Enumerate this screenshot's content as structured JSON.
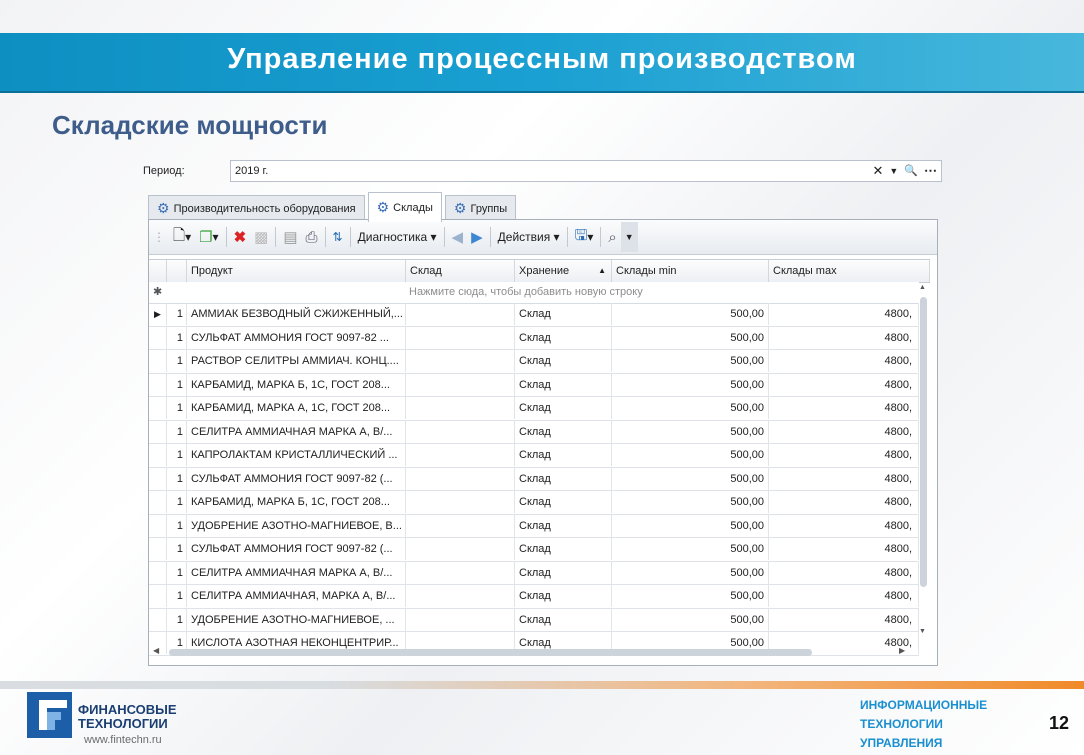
{
  "slide": {
    "title": "Управление процессным производством",
    "subtitle": "Складские мощности",
    "page_number": "12"
  },
  "period": {
    "label": "Период:",
    "value": "2019 г."
  },
  "tabs": [
    {
      "label": "Производительность оборудования",
      "active": false
    },
    {
      "label": "Склады",
      "active": true
    },
    {
      "label": "Группы",
      "active": false
    }
  ],
  "toolbar": {
    "diagnostics_label": "Диагностика",
    "actions_label": "Действия"
  },
  "grid": {
    "columns": [
      "Продукт",
      "Склад",
      "Хранение",
      "Склады min",
      "Склады max"
    ],
    "new_row_hint": "Нажмите сюда, чтобы добавить новую строку",
    "rows": [
      {
        "num": "1",
        "product": "АММИАК БЕЗВОДНЫЙ СЖИЖЕННЫЙ,...",
        "sklad": "",
        "storage": "Склад",
        "min": "500,00",
        "max": "4800,"
      },
      {
        "num": "1",
        "product": "СУЛЬФАТ АММОНИЯ ГОСТ 9097-82 ...",
        "sklad": "",
        "storage": "Склад",
        "min": "500,00",
        "max": "4800,"
      },
      {
        "num": "1",
        "product": "РАСТВОР СЕЛИТРЫ АММИАЧ. КОНЦ....",
        "sklad": "",
        "storage": "Склад",
        "min": "500,00",
        "max": "4800,"
      },
      {
        "num": "1",
        "product": "КАРБАМИД, МАРКА Б, 1С, ГОСТ 208...",
        "sklad": "",
        "storage": "Склад",
        "min": "500,00",
        "max": "4800,"
      },
      {
        "num": "1",
        "product": "КАРБАМИД, МАРКА А, 1С, ГОСТ 208...",
        "sklad": "",
        "storage": "Склад",
        "min": "500,00",
        "max": "4800,"
      },
      {
        "num": "1",
        "product": "СЕЛИТРА АММИАЧНАЯ  МАРКА А, В/...",
        "sklad": "",
        "storage": "Склад",
        "min": "500,00",
        "max": "4800,"
      },
      {
        "num": "1",
        "product": "КАПРОЛАКТАМ КРИСТАЛЛИЧЕСКИЙ ...",
        "sklad": "",
        "storage": "Склад",
        "min": "500,00",
        "max": "4800,"
      },
      {
        "num": "1",
        "product": "СУЛЬФАТ АММОНИЯ ГОСТ 9097-82 (...",
        "sklad": "",
        "storage": "Склад",
        "min": "500,00",
        "max": "4800,"
      },
      {
        "num": "1",
        "product": "КАРБАМИД, МАРКА Б, 1С, ГОСТ 208...",
        "sklad": "",
        "storage": "Склад",
        "min": "500,00",
        "max": "4800,"
      },
      {
        "num": "1",
        "product": "УДОБРЕНИЕ АЗОТНО-МАГНИЕВОЕ, В...",
        "sklad": "",
        "storage": "Склад",
        "min": "500,00",
        "max": "4800,"
      },
      {
        "num": "1",
        "product": "СУЛЬФАТ АММОНИЯ ГОСТ 9097-82 (...",
        "sklad": "",
        "storage": "Склад",
        "min": "500,00",
        "max": "4800,"
      },
      {
        "num": "1",
        "product": "СЕЛИТРА АММИАЧНАЯ  МАРКА А, В/...",
        "sklad": "",
        "storage": "Склад",
        "min": "500,00",
        "max": "4800,"
      },
      {
        "num": "1",
        "product": "СЕЛИТРА АММИАЧНАЯ, МАРКА А, В/...",
        "sklad": "",
        "storage": "Склад",
        "min": "500,00",
        "max": "4800,"
      },
      {
        "num": "1",
        "product": "УДОБРЕНИЕ АЗОТНО-МАГНИЕВОЕ, ...",
        "sklad": "",
        "storage": "Склад",
        "min": "500,00",
        "max": "4800,"
      },
      {
        "num": "1",
        "product": "КИСЛОТА АЗОТНАЯ НЕКОНЦЕНТРИР...",
        "sklad": "",
        "storage": "Склад",
        "min": "500,00",
        "max": "4800,"
      }
    ]
  },
  "footer": {
    "logo_line1": "ФИНАНСОВЫЕ",
    "logo_line2": "ТЕХНОЛОГИИ",
    "url": "www.fintechn.ru",
    "right_line1": "ИНФОРМАЦИОННЫЕ",
    "right_line2": "ТЕХНОЛОГИИ",
    "right_line3": "УПРАВЛЕНИЯ"
  },
  "colors": {
    "title_bar": "#1aa0d2",
    "subtitle": "#3f5d8a",
    "footer_accent": "#f08a2a",
    "footer_right_text": "#1a8fd0"
  }
}
